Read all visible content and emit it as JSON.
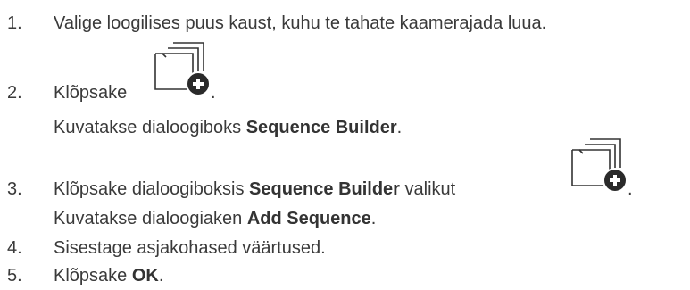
{
  "steps": [
    {
      "number": "1.",
      "text": "Valige loogilises puus kaust, kuhu te tahate kaamerajada luua."
    },
    {
      "number": "2.",
      "text_before": "Klõpsake",
      "text_after": ".",
      "icon": "add-sequence-icon",
      "result_prefix": "Kuvatakse dialoogiboks ",
      "result_bold": "Sequence Builder",
      "result_suffix": "."
    },
    {
      "number": "3.",
      "text_prefix": "Klõpsake dialoogiboksis ",
      "text_bold": "Sequence Builder",
      "text_middle": " valikut",
      "text_after": ".",
      "icon": "add-sequence-icon",
      "result_prefix": "Kuvatakse dialoogiaken ",
      "result_bold": "Add Sequence",
      "result_suffix": "."
    },
    {
      "number": "4.",
      "text": "Sisestage asjakohased väärtused."
    },
    {
      "number": "5.",
      "text_prefix": "Klõpsake ",
      "text_bold": "OK",
      "text_suffix": "."
    }
  ],
  "colors": {
    "text": "#3a3a3a",
    "icon_stroke": "#333333",
    "icon_badge": "#2a2a2a"
  }
}
